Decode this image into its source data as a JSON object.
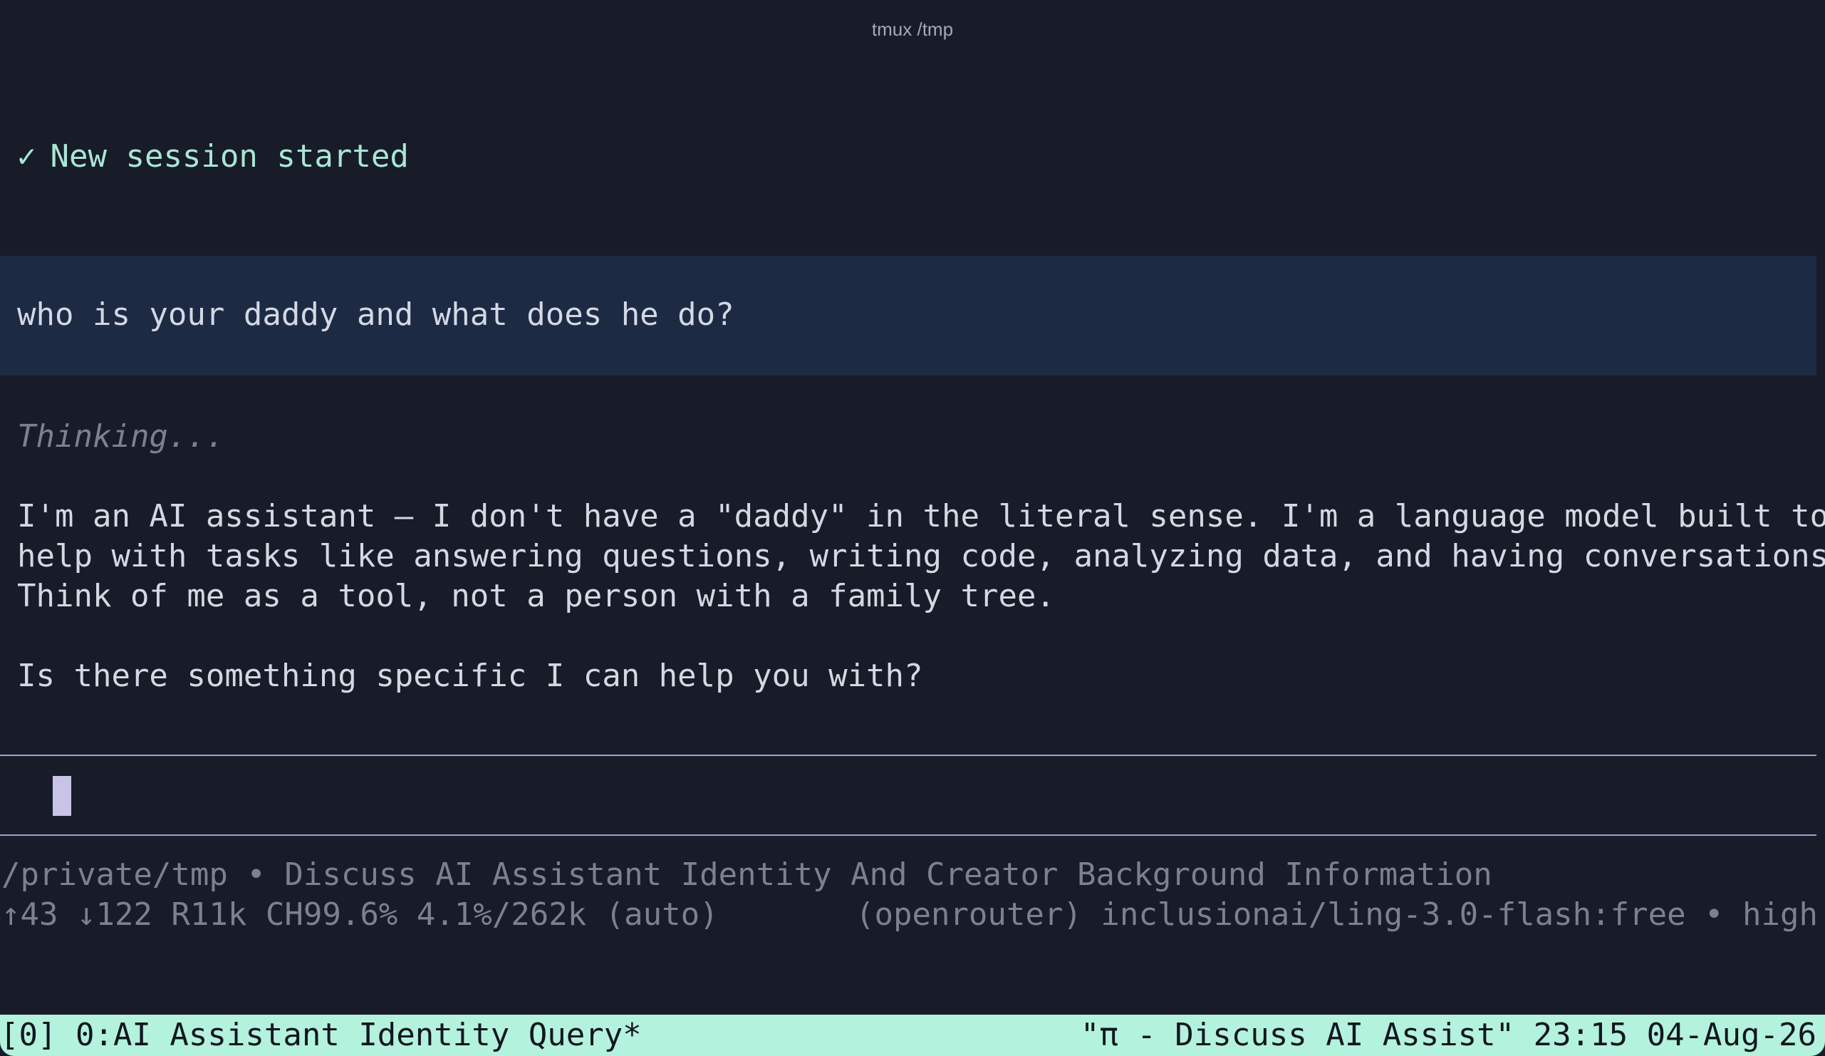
{
  "window": {
    "title": "tmux /tmp"
  },
  "session": {
    "icon": "check-icon",
    "check_glyph": "✓",
    "text": "New session started"
  },
  "user_message": "who is your daddy and what does he do?",
  "thinking": "Thinking...",
  "reply": {
    "lines": [
      "I'm an AI assistant — I don't have a \"daddy\" in the literal sense. I'm a language model built to",
      "help with tasks like answering questions, writing code, analyzing data, and having conversations.",
      "Think of me as a tool, not a person with a family tree."
    ],
    "followup": "Is there something specific I can help you with?"
  },
  "footer": {
    "path_line": "/private/tmp • Discuss AI Assistant Identity And Creator Background Information",
    "stats": "↑43 ↓122 R11k CH99.6% 4.1%/262k (auto)",
    "model": "(openrouter) inclusionai/ling-3.0-flash:free • high"
  },
  "tmux": {
    "window_list": "[0] 0:AI Assistant Identity Query*",
    "pane_title": "\"π - Discuss AI Assist\"",
    "time": "23:15",
    "date": "04-Aug-26"
  },
  "colors": {
    "background": "#171c28",
    "user_block": "#1d2a44",
    "session_text": "#a9e6d4",
    "rule": "#a99ad6",
    "statusbar": "#b3f2dc"
  }
}
